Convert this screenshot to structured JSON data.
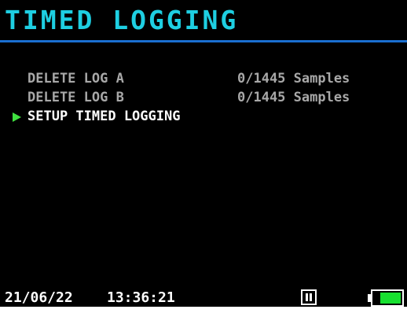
{
  "header": {
    "title": "TIMED LOGGING"
  },
  "menu": {
    "items": [
      {
        "label": "DELETE LOG A",
        "value": "0/1445 Samples",
        "selected": false
      },
      {
        "label": "DELETE LOG B",
        "value": "0/1445 Samples",
        "selected": false
      },
      {
        "label": "SETUP TIMED LOGGING",
        "value": "",
        "selected": true
      }
    ],
    "pointer_icon": "triangle-right-icon"
  },
  "status_bar": {
    "date": "21/06/22",
    "time": "13:36:21",
    "logging_state_icon": "pause-icon",
    "battery_icon": "battery-icon",
    "battery_level": 0.75
  },
  "colors": {
    "background": "#000000",
    "title": "#1ecfe2",
    "title_rule": "#1a6fd0",
    "menu_item": "#a8a8a8",
    "menu_item_selected": "#ffffff",
    "pointer": "#3fe03f",
    "battery_fill": "#18e030",
    "status_text": "#ffffff"
  }
}
